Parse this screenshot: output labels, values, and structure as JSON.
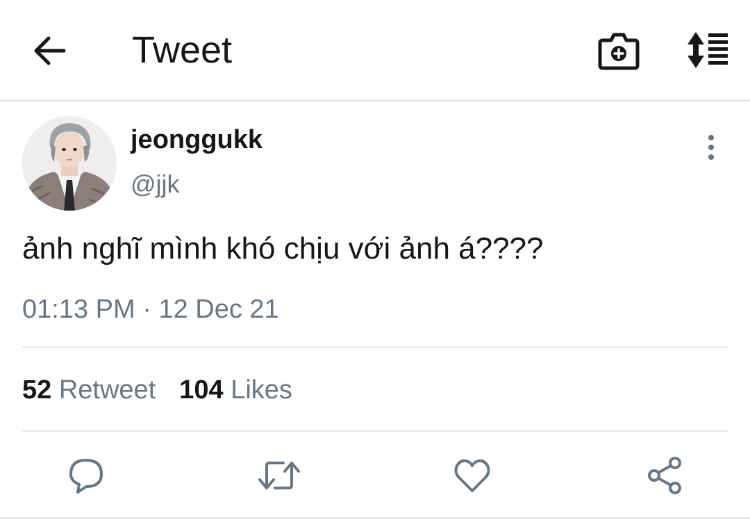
{
  "header": {
    "title": "Tweet",
    "icons": [
      "back-arrow-icon",
      "camera-plus-icon",
      "sort-expand-icon"
    ]
  },
  "tweet": {
    "display_name": "jeonggukk",
    "handle": "@jjk",
    "text": "ảnh nghĩ mình khó chịu với ảnh á????",
    "time": "01:13 PM",
    "separator": " · ",
    "date": "12 Dec 21"
  },
  "stats": {
    "retweets_count": "52",
    "retweets_label": "Retweet",
    "likes_count": "104",
    "likes_label": "Likes"
  },
  "actions": {
    "icons": [
      "reply-icon",
      "retweet-icon",
      "heart-icon",
      "share-icon"
    ]
  },
  "colors": {
    "text_primary": "#14171a",
    "text_secondary": "#657786",
    "icon_action": "#657786",
    "divider": "#e6ecf0"
  }
}
